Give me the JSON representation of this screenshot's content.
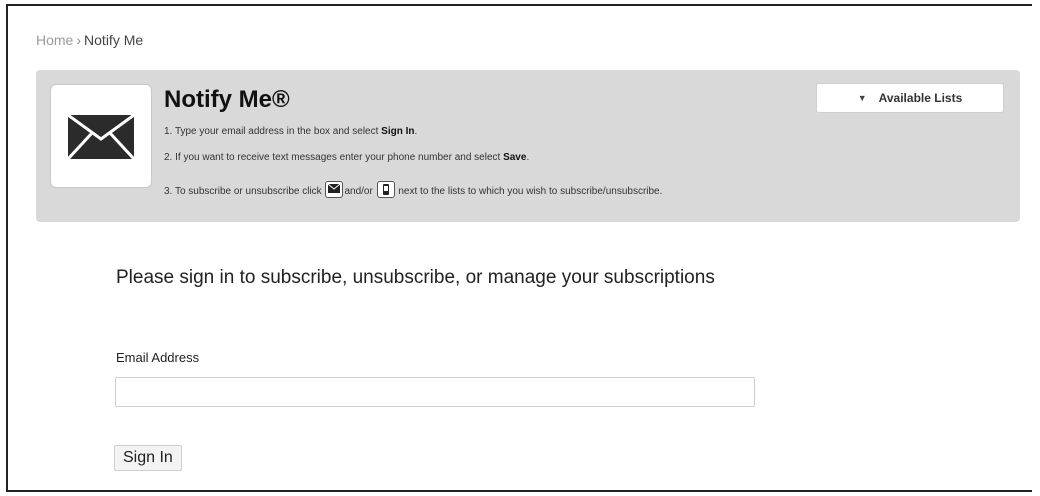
{
  "breadcrumb": {
    "home": "Home",
    "separator": "›",
    "current": "Notify Me"
  },
  "panel": {
    "icon": "envelope-icon",
    "title": "Notify Me®",
    "available_lists_label": "Available Lists",
    "steps": [
      {
        "prefix": "1. Type your email address in the box and select ",
        "bold": "Sign In",
        "suffix": "."
      },
      {
        "prefix": "2. If you want to receive text messages enter your phone number and select ",
        "bold": "Save",
        "suffix": "."
      },
      {
        "prefix": "3. To subscribe or unsubscribe click",
        "middle": "and/or",
        "suffix": "next to the lists to which you wish to subscribe/unsubscribe."
      }
    ]
  },
  "form": {
    "heading": "Please sign in to subscribe, unsubscribe, or manage your subscriptions",
    "email_label": "Email Address",
    "email_value": "",
    "sign_in_label": "Sign In"
  }
}
